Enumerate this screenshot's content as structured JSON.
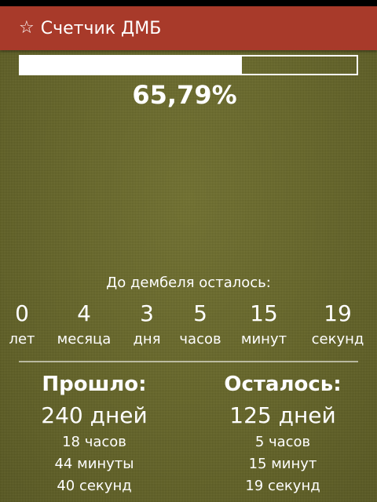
{
  "app": {
    "title": "Счетчик ДМБ",
    "star_glyph": "☆"
  },
  "progress": {
    "fraction": 0.6579,
    "percent_label": "65,79%"
  },
  "remaining": {
    "caption": "До дембеля осталось:",
    "units": [
      {
        "value": "0",
        "label": "лет"
      },
      {
        "value": "4",
        "label": "месяца"
      },
      {
        "value": "3",
        "label": "дня"
      },
      {
        "value": "5",
        "label": "часов"
      },
      {
        "value": "15",
        "label": "минут"
      },
      {
        "value": "19",
        "label": "секунд"
      }
    ]
  },
  "passed": {
    "heading": "Прошло:",
    "days": "240 дней",
    "hours": "18 часов",
    "minutes": "44 минуты",
    "seconds": "40 секунд"
  },
  "left": {
    "heading": "Осталось:",
    "days": "125 дней",
    "hours": "5 часов",
    "minutes": "15 минут",
    "seconds": "19 секунд"
  },
  "colors": {
    "toolbar": "#a83a2a",
    "background": "#6a6a2a",
    "text": "#ffffff"
  }
}
